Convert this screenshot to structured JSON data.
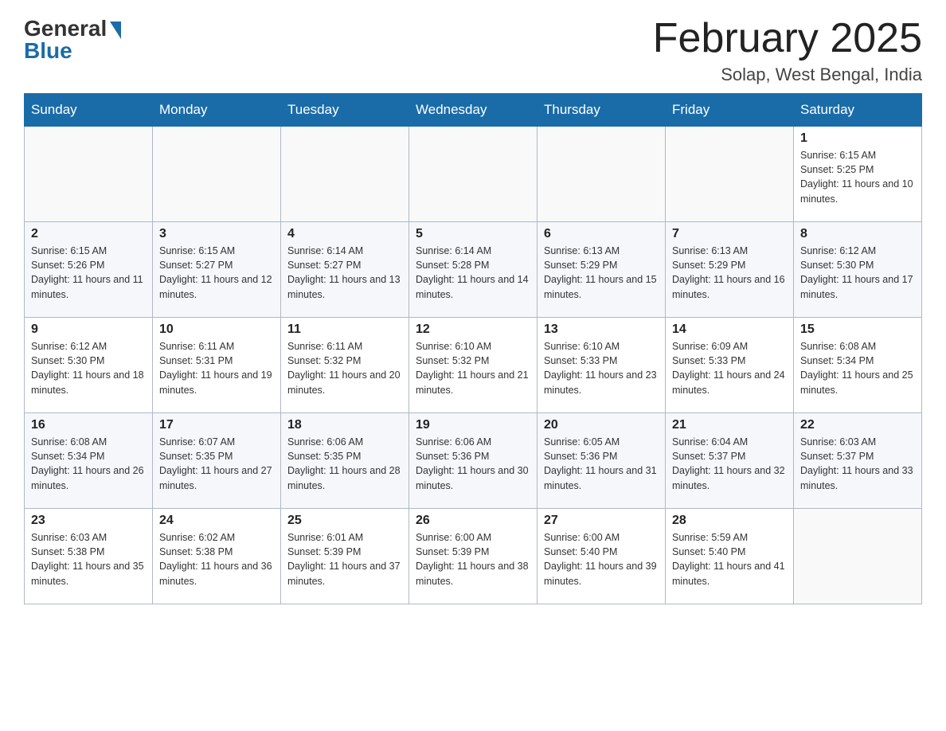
{
  "header": {
    "logo_general": "General",
    "logo_blue": "Blue",
    "month_title": "February 2025",
    "location": "Solap, West Bengal, India"
  },
  "days_of_week": [
    "Sunday",
    "Monday",
    "Tuesday",
    "Wednesday",
    "Thursday",
    "Friday",
    "Saturday"
  ],
  "weeks": [
    [
      {
        "day": "",
        "sunrise": "",
        "sunset": "",
        "daylight": ""
      },
      {
        "day": "",
        "sunrise": "",
        "sunset": "",
        "daylight": ""
      },
      {
        "day": "",
        "sunrise": "",
        "sunset": "",
        "daylight": ""
      },
      {
        "day": "",
        "sunrise": "",
        "sunset": "",
        "daylight": ""
      },
      {
        "day": "",
        "sunrise": "",
        "sunset": "",
        "daylight": ""
      },
      {
        "day": "",
        "sunrise": "",
        "sunset": "",
        "daylight": ""
      },
      {
        "day": "1",
        "sunrise": "Sunrise: 6:15 AM",
        "sunset": "Sunset: 5:25 PM",
        "daylight": "Daylight: 11 hours and 10 minutes."
      }
    ],
    [
      {
        "day": "2",
        "sunrise": "Sunrise: 6:15 AM",
        "sunset": "Sunset: 5:26 PM",
        "daylight": "Daylight: 11 hours and 11 minutes."
      },
      {
        "day": "3",
        "sunrise": "Sunrise: 6:15 AM",
        "sunset": "Sunset: 5:27 PM",
        "daylight": "Daylight: 11 hours and 12 minutes."
      },
      {
        "day": "4",
        "sunrise": "Sunrise: 6:14 AM",
        "sunset": "Sunset: 5:27 PM",
        "daylight": "Daylight: 11 hours and 13 minutes."
      },
      {
        "day": "5",
        "sunrise": "Sunrise: 6:14 AM",
        "sunset": "Sunset: 5:28 PM",
        "daylight": "Daylight: 11 hours and 14 minutes."
      },
      {
        "day": "6",
        "sunrise": "Sunrise: 6:13 AM",
        "sunset": "Sunset: 5:29 PM",
        "daylight": "Daylight: 11 hours and 15 minutes."
      },
      {
        "day": "7",
        "sunrise": "Sunrise: 6:13 AM",
        "sunset": "Sunset: 5:29 PM",
        "daylight": "Daylight: 11 hours and 16 minutes."
      },
      {
        "day": "8",
        "sunrise": "Sunrise: 6:12 AM",
        "sunset": "Sunset: 5:30 PM",
        "daylight": "Daylight: 11 hours and 17 minutes."
      }
    ],
    [
      {
        "day": "9",
        "sunrise": "Sunrise: 6:12 AM",
        "sunset": "Sunset: 5:30 PM",
        "daylight": "Daylight: 11 hours and 18 minutes."
      },
      {
        "day": "10",
        "sunrise": "Sunrise: 6:11 AM",
        "sunset": "Sunset: 5:31 PM",
        "daylight": "Daylight: 11 hours and 19 minutes."
      },
      {
        "day": "11",
        "sunrise": "Sunrise: 6:11 AM",
        "sunset": "Sunset: 5:32 PM",
        "daylight": "Daylight: 11 hours and 20 minutes."
      },
      {
        "day": "12",
        "sunrise": "Sunrise: 6:10 AM",
        "sunset": "Sunset: 5:32 PM",
        "daylight": "Daylight: 11 hours and 21 minutes."
      },
      {
        "day": "13",
        "sunrise": "Sunrise: 6:10 AM",
        "sunset": "Sunset: 5:33 PM",
        "daylight": "Daylight: 11 hours and 23 minutes."
      },
      {
        "day": "14",
        "sunrise": "Sunrise: 6:09 AM",
        "sunset": "Sunset: 5:33 PM",
        "daylight": "Daylight: 11 hours and 24 minutes."
      },
      {
        "day": "15",
        "sunrise": "Sunrise: 6:08 AM",
        "sunset": "Sunset: 5:34 PM",
        "daylight": "Daylight: 11 hours and 25 minutes."
      }
    ],
    [
      {
        "day": "16",
        "sunrise": "Sunrise: 6:08 AM",
        "sunset": "Sunset: 5:34 PM",
        "daylight": "Daylight: 11 hours and 26 minutes."
      },
      {
        "day": "17",
        "sunrise": "Sunrise: 6:07 AM",
        "sunset": "Sunset: 5:35 PM",
        "daylight": "Daylight: 11 hours and 27 minutes."
      },
      {
        "day": "18",
        "sunrise": "Sunrise: 6:06 AM",
        "sunset": "Sunset: 5:35 PM",
        "daylight": "Daylight: 11 hours and 28 minutes."
      },
      {
        "day": "19",
        "sunrise": "Sunrise: 6:06 AM",
        "sunset": "Sunset: 5:36 PM",
        "daylight": "Daylight: 11 hours and 30 minutes."
      },
      {
        "day": "20",
        "sunrise": "Sunrise: 6:05 AM",
        "sunset": "Sunset: 5:36 PM",
        "daylight": "Daylight: 11 hours and 31 minutes."
      },
      {
        "day": "21",
        "sunrise": "Sunrise: 6:04 AM",
        "sunset": "Sunset: 5:37 PM",
        "daylight": "Daylight: 11 hours and 32 minutes."
      },
      {
        "day": "22",
        "sunrise": "Sunrise: 6:03 AM",
        "sunset": "Sunset: 5:37 PM",
        "daylight": "Daylight: 11 hours and 33 minutes."
      }
    ],
    [
      {
        "day": "23",
        "sunrise": "Sunrise: 6:03 AM",
        "sunset": "Sunset: 5:38 PM",
        "daylight": "Daylight: 11 hours and 35 minutes."
      },
      {
        "day": "24",
        "sunrise": "Sunrise: 6:02 AM",
        "sunset": "Sunset: 5:38 PM",
        "daylight": "Daylight: 11 hours and 36 minutes."
      },
      {
        "day": "25",
        "sunrise": "Sunrise: 6:01 AM",
        "sunset": "Sunset: 5:39 PM",
        "daylight": "Daylight: 11 hours and 37 minutes."
      },
      {
        "day": "26",
        "sunrise": "Sunrise: 6:00 AM",
        "sunset": "Sunset: 5:39 PM",
        "daylight": "Daylight: 11 hours and 38 minutes."
      },
      {
        "day": "27",
        "sunrise": "Sunrise: 6:00 AM",
        "sunset": "Sunset: 5:40 PM",
        "daylight": "Daylight: 11 hours and 39 minutes."
      },
      {
        "day": "28",
        "sunrise": "Sunrise: 5:59 AM",
        "sunset": "Sunset: 5:40 PM",
        "daylight": "Daylight: 11 hours and 41 minutes."
      },
      {
        "day": "",
        "sunrise": "",
        "sunset": "",
        "daylight": ""
      }
    ]
  ]
}
